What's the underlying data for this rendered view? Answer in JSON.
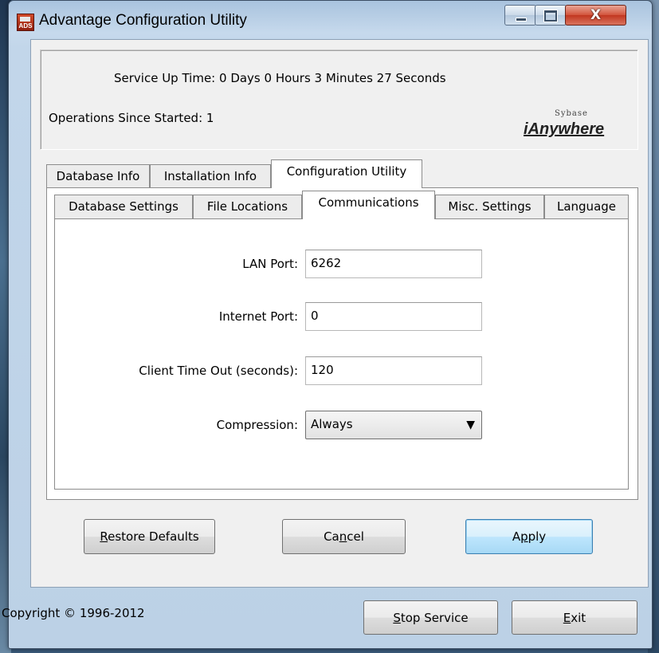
{
  "window": {
    "title": "Advantage Configuration Utility",
    "icon_text": "ADS",
    "close_glyph": "X"
  },
  "status": {
    "service_up_time": "Service Up Time: 0 Days 0 Hours 3 Minutes 27 Seconds",
    "operations_since_started": "Operations Since Started: 1",
    "logo_small": "Sybase",
    "logo_big": "iAnywhere"
  },
  "outer_tabs": [
    {
      "label": "Database Info"
    },
    {
      "label": "Installation Info"
    },
    {
      "label": "Configuration Utility",
      "active": true
    }
  ],
  "inner_tabs": [
    {
      "label": "Database Settings"
    },
    {
      "label": "File Locations"
    },
    {
      "label": "Communications",
      "active": true
    },
    {
      "label": "Misc. Settings"
    },
    {
      "label": "Language"
    }
  ],
  "form": {
    "lan_port_label": "LAN Port:",
    "lan_port_value": "6262",
    "internet_port_label": "Internet Port:",
    "internet_port_value": "0",
    "client_timeout_label": "Client Time Out (seconds):",
    "client_timeout_value": "120",
    "compression_label": "Compression:",
    "compression_value": "Always"
  },
  "buttons": {
    "restore_defaults_pre": "",
    "restore_defaults_key": "R",
    "restore_defaults_post": "estore Defaults",
    "cancel_pre": "Ca",
    "cancel_key": "n",
    "cancel_post": "cel",
    "apply_pre": "A",
    "apply_key": "p",
    "apply_post": "ply",
    "stop_service_pre": "",
    "stop_service_key": "S",
    "stop_service_post": "top Service",
    "exit_pre": "",
    "exit_key": "E",
    "exit_post": "xit"
  },
  "footer": {
    "copyright": "Copyright © 1996-2012"
  }
}
